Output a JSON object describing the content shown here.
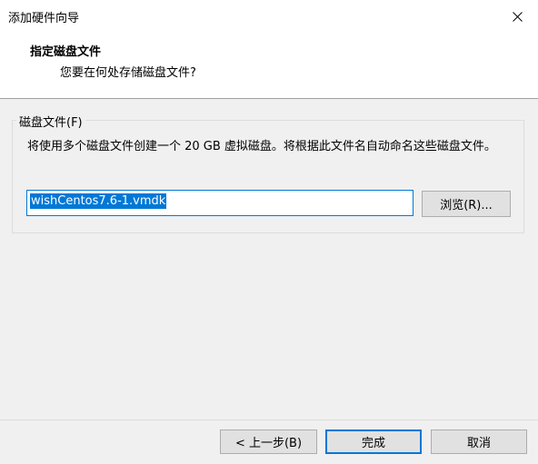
{
  "window": {
    "title": "添加硬件向导",
    "close_icon": "close-icon"
  },
  "header": {
    "title": "指定磁盘文件",
    "subtitle": "您要在何处存储磁盘文件?"
  },
  "disk_file": {
    "group_label": "磁盘文件(F)",
    "description": "将使用多个磁盘文件创建一个 20 GB 虚拟磁盘。将根据此文件名自动命名这些磁盘文件。",
    "filename": "wishCentos7.6-1.vmdk",
    "browse_label": "浏览(R)..."
  },
  "footer": {
    "back_label": "< 上一步(B)",
    "finish_label": "完成",
    "cancel_label": "取消"
  },
  "colors": {
    "accent": "#0078d7",
    "dialog_bg": "#f0f0f0",
    "button_bg": "#e1e1e1"
  }
}
